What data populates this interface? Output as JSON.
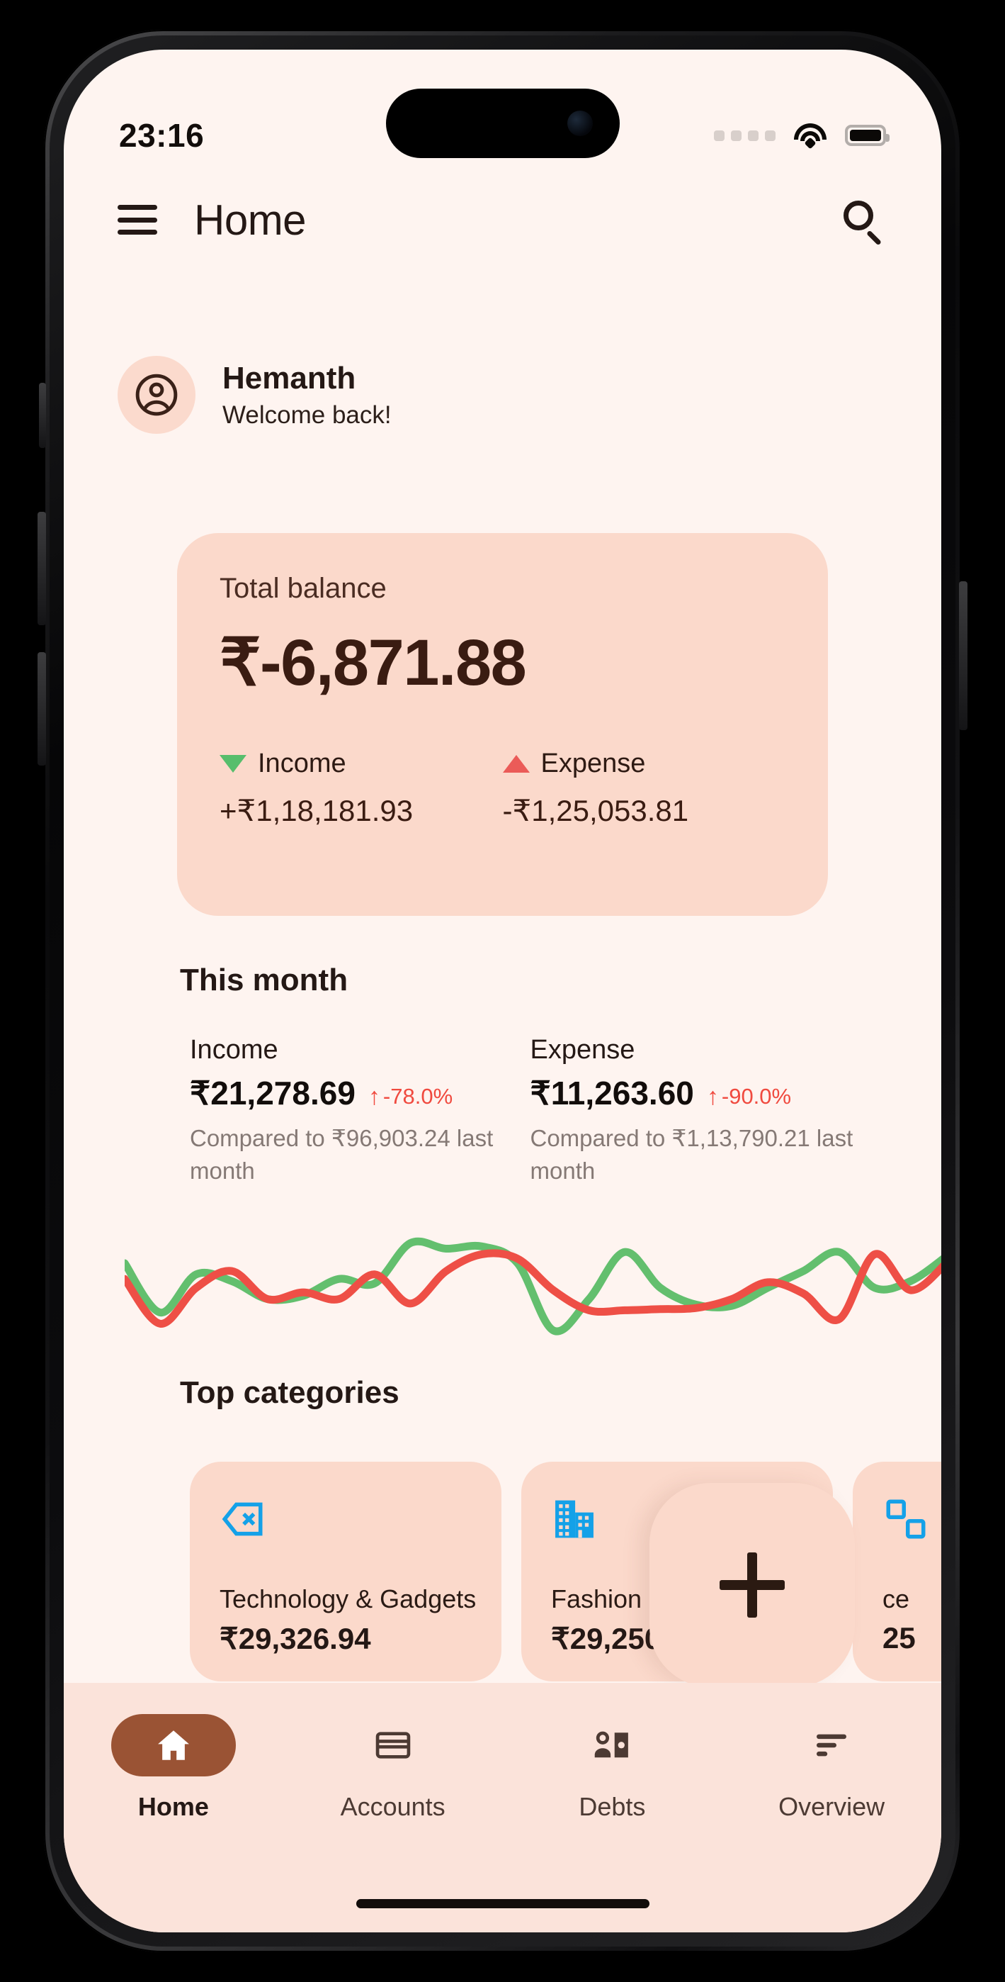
{
  "status_bar": {
    "time": "23:16",
    "signal_icon": "cellular-dots-icon",
    "wifi_icon": "wifi-icon",
    "battery_icon": "battery-icon"
  },
  "header": {
    "menu_icon": "hamburger-menu-icon",
    "title": "Home",
    "search_icon": "search-icon"
  },
  "profile": {
    "avatar_icon": "user-circle-icon",
    "name": "Hemanth",
    "greeting": "Welcome back!"
  },
  "balance_card": {
    "label": "Total balance",
    "amount": "₹-6,871.88",
    "income": {
      "icon": "triangle-down-icon",
      "label": "Income",
      "value": "+₹1,18,181.93",
      "color": "#57BE6C"
    },
    "expense": {
      "icon": "triangle-up-icon",
      "label": "Expense",
      "value": "-₹1,25,053.81",
      "color": "#EB5B58"
    }
  },
  "this_month": {
    "title": "This month",
    "stats": [
      {
        "label": "Income",
        "amount": "₹21,278.69",
        "delta_arrow": "↑",
        "delta": "-78.0%",
        "comparison": "Compared to ₹96,903.24 last month"
      },
      {
        "label": "Expense",
        "amount": "₹11,263.60",
        "delta_arrow": "↑",
        "delta": "-90.0%",
        "comparison": "Compared to ₹1,13,790.21 last month"
      }
    ]
  },
  "chart_data": {
    "type": "line",
    "title": "",
    "xlabel": "",
    "ylabel": "",
    "grid": false,
    "legend": "none",
    "series": [
      {
        "name": "Income",
        "color": "#63BF6E",
        "values": [
          62,
          18,
          52,
          46,
          30,
          33,
          48,
          44,
          80,
          75,
          77,
          62,
          2,
          30,
          72,
          40,
          25,
          24,
          40,
          55,
          72,
          40,
          46,
          68
        ]
      },
      {
        "name": "Expense",
        "color": "#EE4F46",
        "values": [
          48,
          8,
          40,
          55,
          30,
          36,
          30,
          52,
          26,
          55,
          70,
          66,
          38,
          20,
          20,
          21,
          22,
          30,
          45,
          35,
          12,
          70,
          38,
          62
        ]
      }
    ]
  },
  "top_categories": {
    "title": "Top categories",
    "items": [
      {
        "icon": "backspace-delete-icon",
        "icon_color": "#14A1E8",
        "name": "Technology & Gadgets",
        "amount": "₹29,326.94"
      },
      {
        "icon": "office-building-icon",
        "icon_color": "#14A1E8",
        "name": "Fashion & Accessories",
        "amount": "₹29,250.95"
      },
      {
        "icon": "category-icon",
        "icon_color": "#14A1E8",
        "name": "ce",
        "amount": "25"
      }
    ]
  },
  "fab": {
    "icon": "plus-icon",
    "label": "Add"
  },
  "bottom_nav": {
    "active": "Home",
    "items": [
      {
        "icon": "home-icon",
        "label": "Home"
      },
      {
        "icon": "credit-card-icon",
        "label": "Accounts"
      },
      {
        "icon": "person-money-icon",
        "label": "Debts"
      },
      {
        "icon": "bars-overview-icon",
        "label": "Overview"
      }
    ]
  },
  "theme": {
    "background": "#FEF4F0",
    "card": "#FBD9CB",
    "nav_background": "#FBE3DA",
    "accent": "#9A5334",
    "text": "#241815",
    "positive": "#57BE6C",
    "negative": "#EB5B58"
  }
}
